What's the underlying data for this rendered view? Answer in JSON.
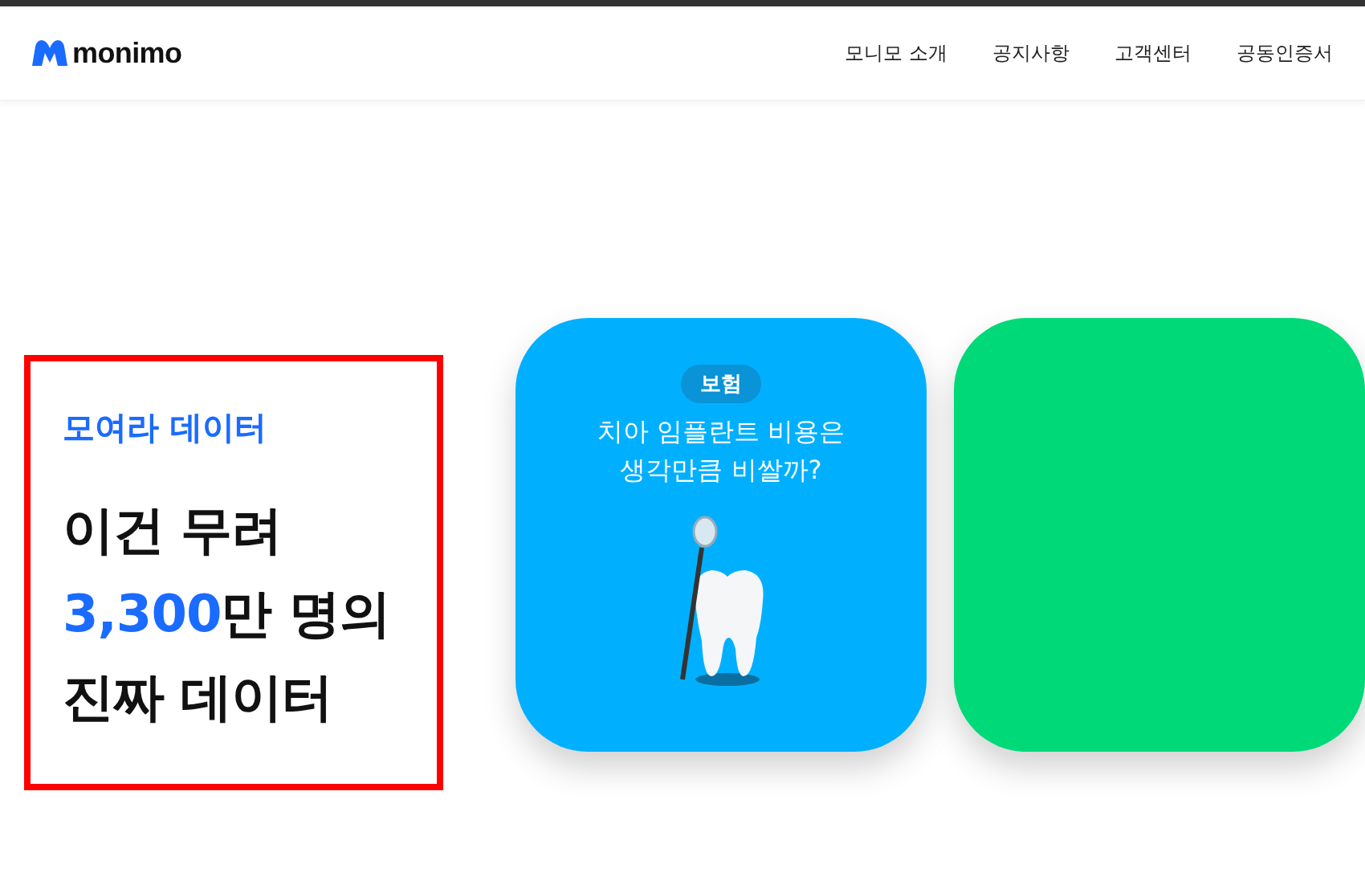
{
  "header": {
    "logo": "monimo",
    "nav": [
      "모니모 소개",
      "공지사항",
      "고객센터",
      "공동인증서"
    ]
  },
  "hero": {
    "eyebrow": "모여라 데이터",
    "headline_line1": "이건 무려",
    "headline_line2": "**3,300**만 명의 진짜 데이터"
  },
  "cards": [
    {
      "color": "#00b0ff",
      "badge": "보험",
      "title_line1": "치아 임플란트 비용은",
      "title_line2": "생각만큼 비쌀까?",
      "kind": "tooth"
    },
    {
      "color": "#00d978",
      "kind": "blank"
    }
  ]
}
